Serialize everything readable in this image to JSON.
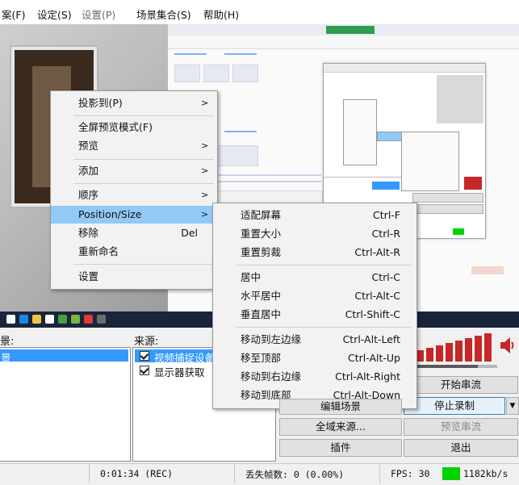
{
  "menubar": {
    "items": [
      "案(F)",
      "设定(S)",
      "设置(P)",
      "场景集合(S)",
      "帮助(H)"
    ]
  },
  "context_menu": {
    "items": [
      {
        "label": "投影到(P)",
        "has_submenu": true
      },
      {
        "label": "全屏预览模式(F)"
      },
      {
        "label": "预览",
        "has_submenu": true
      },
      {
        "label": "添加",
        "has_submenu": true
      },
      {
        "label": "顺序",
        "has_submenu": true
      },
      {
        "label": "Position/Size",
        "has_submenu": true,
        "highlighted": true
      },
      {
        "label": "移除",
        "shortcut": "Del"
      },
      {
        "label": "重新命名"
      },
      {
        "label": "设置"
      }
    ]
  },
  "submenu": {
    "items": [
      {
        "label": "适配屏幕",
        "shortcut": "Ctrl-F"
      },
      {
        "label": "重置大小",
        "shortcut": "Ctrl-R"
      },
      {
        "label": "重置剪裁",
        "shortcut": "Ctrl-Alt-R"
      },
      {
        "label": "居中",
        "shortcut": "Ctrl-C"
      },
      {
        "label": "水平居中",
        "shortcut": "Ctrl-Alt-C"
      },
      {
        "label": "垂直居中",
        "shortcut": "Ctrl-Shift-C"
      },
      {
        "label": "移动到左边缘",
        "shortcut": "Ctrl-Alt-Left"
      },
      {
        "label": "移至顶部",
        "shortcut": "Ctrl-Alt-Up"
      },
      {
        "label": "移动到右边缘",
        "shortcut": "Ctrl-Alt-Right"
      },
      {
        "label": "移动到底部",
        "shortcut": "Ctrl-Alt-Down"
      }
    ]
  },
  "scenes": {
    "header": "景:",
    "items": [
      "景"
    ]
  },
  "sources": {
    "header": "来源:",
    "items": [
      {
        "label": "视频捕捉设备",
        "checked": true,
        "selected": true
      },
      {
        "label": "显示器获取",
        "checked": true,
        "selected": false
      }
    ]
  },
  "controls": {
    "start_stream": "开始串流",
    "stop_record": "停止录制",
    "preview_stream": "预览串流",
    "global_sources": "全域来源...",
    "plugins": "插件",
    "exit": "退出",
    "edit_scene": "编辑场景"
  },
  "status": {
    "time": "0:01:34 (REC)",
    "dropped": "丢失帧数: 0 (0.00%)",
    "fps": "FPS: 30",
    "bitrate": "1182kb/s"
  },
  "colors": {
    "highlight": "#91c9f7",
    "selected_row": "#3399ff",
    "meter": "#c62828",
    "bitrate_indicator": "#00d400"
  },
  "icons": [
    "speaker-icon",
    "submenu-arrow-icon",
    "checkbox-icon",
    "dropdown-arrow-icon"
  ]
}
